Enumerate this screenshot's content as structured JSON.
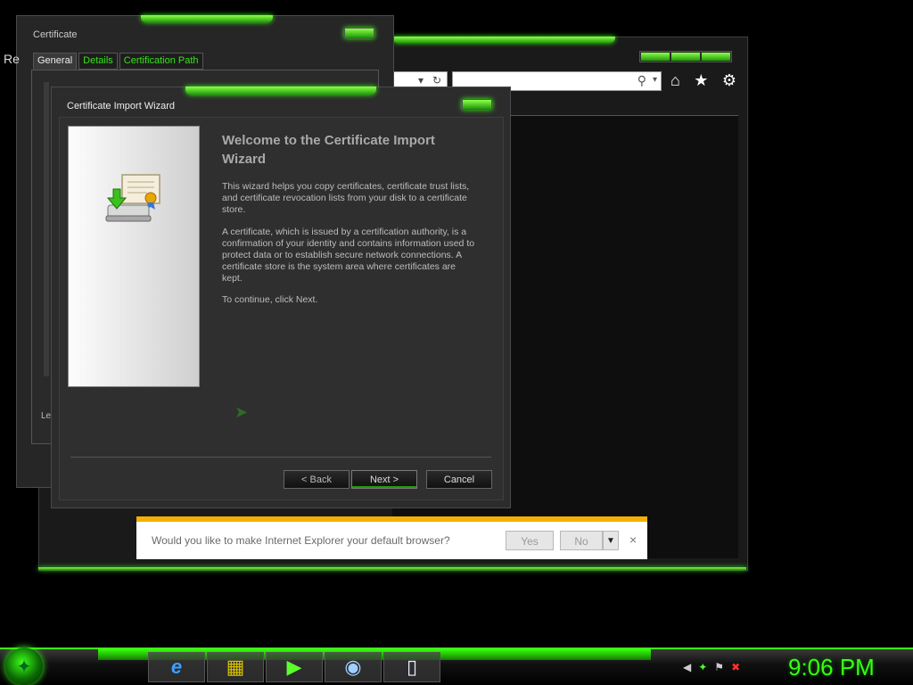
{
  "ie": {
    "search_placeholder": "",
    "icons": [
      "home-icon",
      "star-icon",
      "gear-icon"
    ]
  },
  "notification": {
    "text": "Would you like to make Internet Explorer your default browser?",
    "yes_label": "Yes",
    "no_label": "No",
    "close_glyph": "×"
  },
  "certificate": {
    "title": "Certificate",
    "edge_text": "Re",
    "tabs": [
      "General",
      "Details",
      "Certification Path"
    ],
    "left_text": "Le"
  },
  "wizard": {
    "title": "Certificate Import Wizard",
    "heading": "Welcome to the Certificate Import Wizard",
    "para1": "This wizard helps you copy certificates, certificate trust lists, and certificate revocation lists from your disk to a certificate store.",
    "para2": "A certificate, which is issued by a certification authority, is a confirmation of your identity and contains information used to protect data or to establish secure network connections. A certificate store is the system area where certificates are kept.",
    "para3": "To continue, click Next.",
    "back_label": "< Back",
    "next_label": "Next >",
    "cancel_label": "Cancel"
  },
  "taskbar": {
    "clock": "9:06 PM",
    "items": [
      "internet-explorer",
      "cube-app",
      "media-player",
      "disc-app",
      "document"
    ]
  },
  "colors": {
    "accent": "#39ff14",
    "notification_border": "#f4b000"
  }
}
